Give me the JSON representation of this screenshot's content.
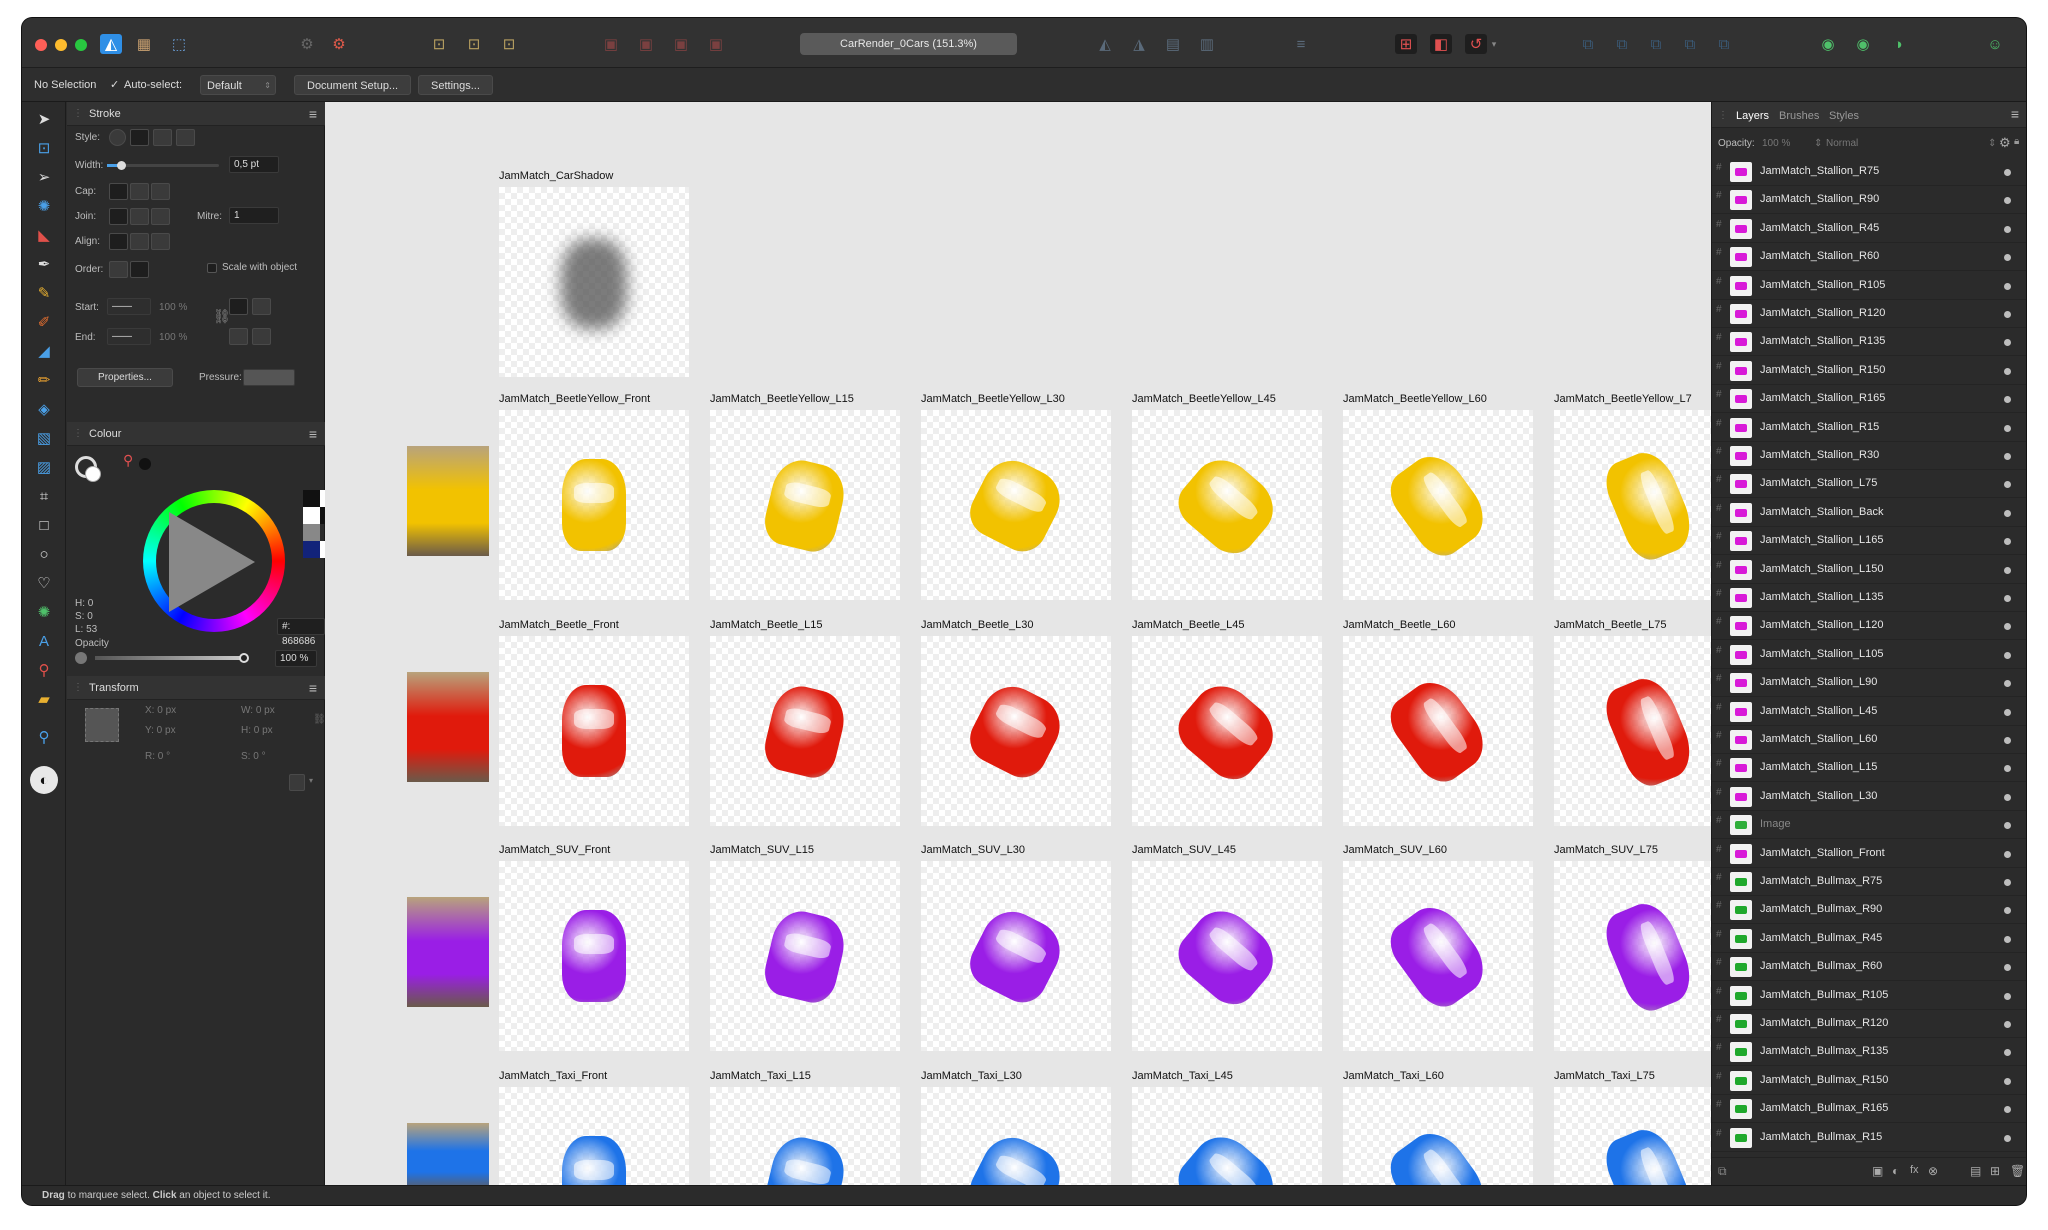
{
  "window": {
    "traffic_lights": [
      "#ff5f57",
      "#febc2e",
      "#28c840"
    ]
  },
  "toolbar": {
    "doc_title": "CarRender_0Cars (151.3%)"
  },
  "context": {
    "selection": "No Selection",
    "auto_select_label": "Auto-select:",
    "auto_select_value": "Default",
    "doc_setup": "Document Setup...",
    "settings": "Settings..."
  },
  "stroke": {
    "title": "Stroke",
    "style_label": "Style:",
    "width_label": "Width:",
    "width_value": "0,5 pt",
    "cap_label": "Cap:",
    "join_label": "Join:",
    "mitre_label": "Mitre:",
    "mitre_value": "1",
    "align_label": "Align:",
    "order_label": "Order:",
    "scale_label": "Scale with object",
    "start_label": "Start:",
    "start_pct": "100 %",
    "end_label": "End:",
    "end_pct": "100 %",
    "properties": "Properties...",
    "pressure_label": "Pressure:"
  },
  "colour": {
    "title": "Colour",
    "h": "H: 0",
    "s": "S: 0",
    "l": "L: 53",
    "hex": "#: 868686",
    "opacity_label": "Opacity",
    "opacity_value": "100 %"
  },
  "transform": {
    "title": "Transform",
    "x": "X: 0 px",
    "y": "Y: 0 px",
    "w": "W: 0 px",
    "h": "H: 0 px",
    "r": "R: 0 °",
    "s": "S: 0 °"
  },
  "canvas": {
    "shadow_label": "JamMatch_CarShadow",
    "rows": [
      {
        "color": "#f2c200",
        "labels": [
          "JamMatch_BeetleYellow_Front",
          "JamMatch_BeetleYellow_L15",
          "JamMatch_BeetleYellow_L30",
          "JamMatch_BeetleYellow_L45",
          "JamMatch_BeetleYellow_L60",
          "JamMatch_BeetleYellow_L7"
        ]
      },
      {
        "color": "#e01a0c",
        "labels": [
          "JamMatch_Beetle_Front",
          "JamMatch_Beetle_L15",
          "JamMatch_Beetle_L30",
          "JamMatch_Beetle_L45",
          "JamMatch_Beetle_L60",
          "JamMatch_Beetle_L75"
        ]
      },
      {
        "color": "#9a1ee6",
        "labels": [
          "JamMatch_SUV_Front",
          "JamMatch_SUV_L15",
          "JamMatch_SUV_L30",
          "JamMatch_SUV_L45",
          "JamMatch_SUV_L60",
          "JamMatch_SUV_L75"
        ]
      },
      {
        "color": "#1e73e8",
        "labels": [
          "JamMatch_Taxi_Front",
          "JamMatch_Taxi_L15",
          "JamMatch_Taxi_L30",
          "JamMatch_Taxi_L45",
          "JamMatch_Taxi_L60",
          "JamMatch_Taxi_L75"
        ]
      }
    ]
  },
  "layers_panel": {
    "tabs": [
      "Layers",
      "Brushes",
      "Styles"
    ],
    "opacity_label": "Opacity:",
    "opacity_value": "100 %",
    "blend": "Normal",
    "layers": [
      {
        "name": "JamMatch_Stallion_R75",
        "color": "#d81ad8"
      },
      {
        "name": "JamMatch_Stallion_R90",
        "color": "#d81ad8"
      },
      {
        "name": "JamMatch_Stallion_R45",
        "color": "#d81ad8"
      },
      {
        "name": "JamMatch_Stallion_R60",
        "color": "#d81ad8"
      },
      {
        "name": "JamMatch_Stallion_R105",
        "color": "#d81ad8"
      },
      {
        "name": "JamMatch_Stallion_R120",
        "color": "#d81ad8"
      },
      {
        "name": "JamMatch_Stallion_R135",
        "color": "#d81ad8"
      },
      {
        "name": "JamMatch_Stallion_R150",
        "color": "#d81ad8"
      },
      {
        "name": "JamMatch_Stallion_R165",
        "color": "#d81ad8"
      },
      {
        "name": "JamMatch_Stallion_R15",
        "color": "#d81ad8"
      },
      {
        "name": "JamMatch_Stallion_R30",
        "color": "#d81ad8"
      },
      {
        "name": "JamMatch_Stallion_L75",
        "color": "#d81ad8"
      },
      {
        "name": "JamMatch_Stallion_Back",
        "color": "#d81ad8"
      },
      {
        "name": "JamMatch_Stallion_L165",
        "color": "#d81ad8"
      },
      {
        "name": "JamMatch_Stallion_L150",
        "color": "#d81ad8"
      },
      {
        "name": "JamMatch_Stallion_L135",
        "color": "#d81ad8"
      },
      {
        "name": "JamMatch_Stallion_L120",
        "color": "#d81ad8"
      },
      {
        "name": "JamMatch_Stallion_L105",
        "color": "#d81ad8"
      },
      {
        "name": "JamMatch_Stallion_L90",
        "color": "#d81ad8"
      },
      {
        "name": "JamMatch_Stallion_L45",
        "color": "#d81ad8"
      },
      {
        "name": "JamMatch_Stallion_L60",
        "color": "#d81ad8"
      },
      {
        "name": "JamMatch_Stallion_L15",
        "color": "#d81ad8"
      },
      {
        "name": "JamMatch_Stallion_L30",
        "color": "#d81ad8"
      },
      {
        "name": "Image",
        "color": "#2fae3a",
        "dim": true
      },
      {
        "name": "JamMatch_Stallion_Front",
        "color": "#d81ad8"
      },
      {
        "name": "JamMatch_Bullmax_R75",
        "color": "#1fa82c"
      },
      {
        "name": "JamMatch_Bullmax_R90",
        "color": "#1fa82c"
      },
      {
        "name": "JamMatch_Bullmax_R45",
        "color": "#1fa82c"
      },
      {
        "name": "JamMatch_Bullmax_R60",
        "color": "#1fa82c"
      },
      {
        "name": "JamMatch_Bullmax_R105",
        "color": "#1fa82c"
      },
      {
        "name": "JamMatch_Bullmax_R120",
        "color": "#1fa82c"
      },
      {
        "name": "JamMatch_Bullmax_R135",
        "color": "#1fa82c"
      },
      {
        "name": "JamMatch_Bullmax_R150",
        "color": "#1fa82c"
      },
      {
        "name": "JamMatch_Bullmax_R165",
        "color": "#1fa82c"
      },
      {
        "name": "JamMatch_Bullmax_R15",
        "color": "#1fa82c"
      }
    ]
  },
  "status": {
    "b1": "Drag",
    "t1": " to marquee select. ",
    "b2": "Click",
    "t2": " an object to select it."
  }
}
